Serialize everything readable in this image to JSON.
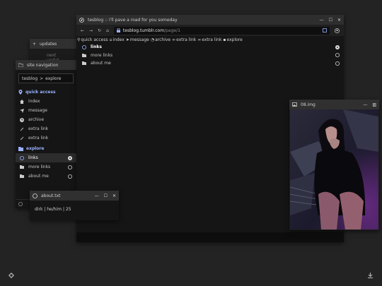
{
  "browser": {
    "title": "tesblog :: i'll pave a road for you someday",
    "url_domain": "tesblog.tumblr.com",
    "url_path": "/page/1",
    "bookmarks": [
      "quick access",
      "index",
      "message",
      "archive",
      "extra link",
      "extra link",
      "explore"
    ],
    "links": [
      {
        "label": "links"
      },
      {
        "label": "more links"
      },
      {
        "label": "about me"
      }
    ]
  },
  "updates": {
    "title": "updates",
    "preview": "next updat"
  },
  "sitenav": {
    "title": "site navigation",
    "crumb_root": "tesblog",
    "crumb_sep": ">",
    "crumb_leaf": "explore",
    "quick_access": "quick access",
    "quick_items": [
      "index",
      "message",
      "archive",
      "extra link",
      "extra link"
    ],
    "explore": "explore",
    "explore_items": [
      "links",
      "more links",
      "about me"
    ]
  },
  "image": {
    "title": "08.img"
  },
  "about": {
    "title": "about.txt",
    "body": "dirk | he/him | 25"
  },
  "colors": {
    "accent": "#9ab2ff",
    "bg": "#232323",
    "window": "#151515"
  }
}
